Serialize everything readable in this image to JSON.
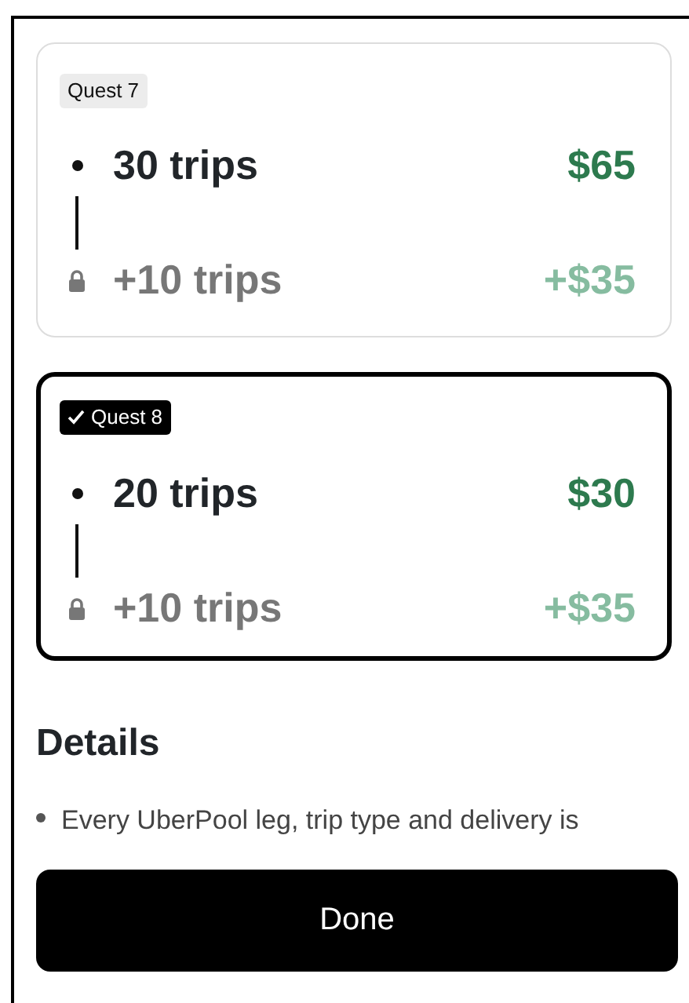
{
  "quests": [
    {
      "label": "Quest 7",
      "selected": false,
      "tiers": [
        {
          "trips": "30 trips",
          "reward": "$65",
          "locked": false
        },
        {
          "trips": "+10 trips",
          "reward": "+$35",
          "locked": true
        }
      ]
    },
    {
      "label": "Quest 8",
      "selected": true,
      "tiers": [
        {
          "trips": "20 trips",
          "reward": "$30",
          "locked": false
        },
        {
          "trips": "+10 trips",
          "reward": "+$35",
          "locked": true
        }
      ]
    }
  ],
  "details": {
    "title": "Details",
    "items": [
      "Every UberPool leg, trip type and delivery is"
    ]
  },
  "button": "Done"
}
